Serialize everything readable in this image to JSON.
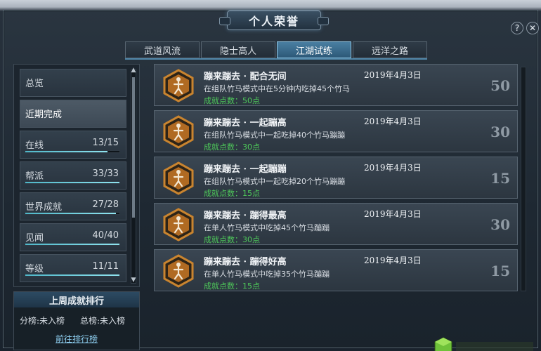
{
  "window": {
    "title": "个人荣誉",
    "help_icon": "question-icon",
    "close_icon": "close-icon",
    "help_label": "?",
    "close_label": "✕"
  },
  "tabs": [
    {
      "label": "武道风流",
      "active": false
    },
    {
      "label": "隐士高人",
      "active": false
    },
    {
      "label": "江湖试练",
      "active": true
    },
    {
      "label": "远洋之路",
      "active": false
    }
  ],
  "sidebar": {
    "items": [
      {
        "label": "总览",
        "value": "",
        "progress": null
      },
      {
        "label": "近期完成",
        "value": "",
        "progress": null
      },
      {
        "label": "在线",
        "value": "13/15",
        "progress": 0.87
      },
      {
        "label": "帮派",
        "value": "33/33",
        "progress": 1.0
      },
      {
        "label": "世界成就",
        "value": "27/28",
        "progress": 0.96
      },
      {
        "label": "见闻",
        "value": "40/40",
        "progress": 1.0
      },
      {
        "label": "等级",
        "value": "11/11",
        "progress": 1.0
      }
    ]
  },
  "ranking": {
    "title": "上周成就排行",
    "branch": "分榜:未入榜",
    "total": "总榜:未入榜",
    "link": "前往排行榜"
  },
  "achievements": [
    {
      "name": "蹦来蹦去 · 配合无间",
      "date": "2019年4月3日",
      "desc": "在组队竹马模式中在5分钟内吃掉45个竹马",
      "points": "成就点数：50点",
      "score": "50"
    },
    {
      "name": "蹦来蹦去 · 一起蹦高",
      "date": "2019年4月3日",
      "desc": "在组队竹马模式中一起吃掉40个竹马蹦蹦",
      "points": "成就点数：30点",
      "score": "30"
    },
    {
      "name": "蹦来蹦去 · 一起蹦蹦",
      "date": "2019年4月3日",
      "desc": "在组队竹马模式中一起吃掉20个竹马蹦蹦",
      "points": "成就点数：15点",
      "score": "15"
    },
    {
      "name": "蹦来蹦去 · 蹦得最高",
      "date": "2019年4月3日",
      "desc": "在单人竹马模式中吃掉45个竹马蹦蹦",
      "points": "成就点数：30点",
      "score": "30"
    },
    {
      "name": "蹦来蹦去 · 蹦得好高",
      "date": "2019年4月3日",
      "desc": "在单人竹马模式中吃掉35个竹马蹦蹦",
      "points": "成就点数：15点",
      "score": "15"
    }
  ],
  "colors": {
    "accent": "#4a7fa2",
    "points_green": "#4ec95a",
    "badge_orange": "#c9842f",
    "progress": "#6fd0e0"
  },
  "icons": {
    "badge": "figure-badge-icon",
    "scroll_up": "arrow-up-icon",
    "scroll_down": "arrow-down-icon",
    "logo": "cube-logo-icon"
  }
}
